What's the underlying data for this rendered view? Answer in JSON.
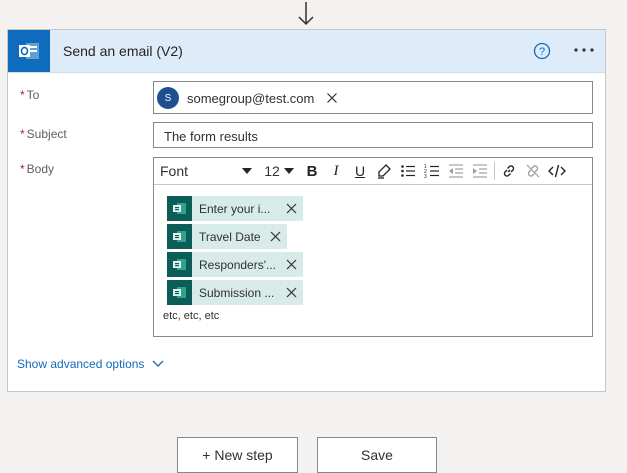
{
  "action": {
    "title": "Send an email (V2)",
    "app_icon": "outlook-icon",
    "help_icon": "help-icon",
    "more_icon": "more-options-icon"
  },
  "fields": {
    "to": {
      "label": "To",
      "recipient": {
        "initial": "S",
        "email": "somegroup@test.com"
      }
    },
    "subject": {
      "label": "Subject",
      "value": "The form results"
    },
    "body": {
      "label": "Body",
      "toolbar": {
        "font": "Font",
        "size": "12",
        "bold": "B",
        "italic": "I",
        "underline": "U"
      },
      "tokens": [
        {
          "label": "Enter your i..."
        },
        {
          "label": "Travel Date"
        },
        {
          "label": "Responders'..."
        },
        {
          "label": "Submission ..."
        }
      ],
      "trailing_text": "etc, etc, etc"
    }
  },
  "advanced_options_label": "Show advanced options",
  "buttons": {
    "new_step": "+ New step",
    "save": "Save"
  },
  "colors": {
    "header_bg": "#deecf9",
    "brand_blue": "#0f6cbd",
    "token_bg": "#d7ebe9",
    "token_icon_bg": "#0b5d57",
    "required": "#a4262c"
  }
}
